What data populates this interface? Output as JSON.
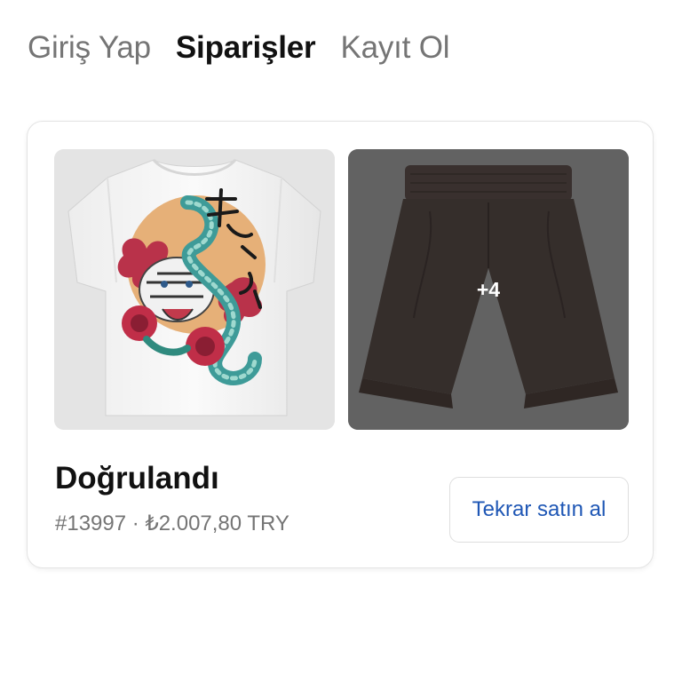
{
  "tabs": [
    {
      "label": "Giriş Yap",
      "active": false
    },
    {
      "label": "Siparişler",
      "active": true
    },
    {
      "label": "Kayıt Ol",
      "active": false
    }
  ],
  "order": {
    "items": [
      {
        "image": "white-tshirt-tiger-snake-print-image"
      },
      {
        "image": "dark-brown-shorts-image",
        "more_count_label": "+4"
      }
    ],
    "status": "Doğrulandı",
    "number": "#13997",
    "separator": "·",
    "total": "₺2.007,80 TRY",
    "reorder_label": "Tekrar satın al"
  },
  "colors": {
    "active_tab": "#111111",
    "inactive_tab": "#757575",
    "link_blue": "#1f57b5",
    "card_border": "#e3e3e3"
  }
}
